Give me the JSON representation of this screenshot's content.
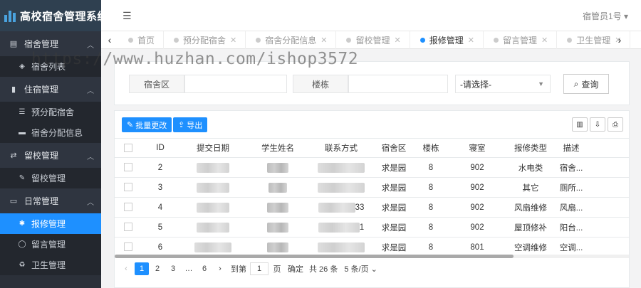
{
  "app": {
    "title": "高校宿舍管理系统"
  },
  "topbar": {
    "user": "宿管员1号 ▾"
  },
  "watermark": "https://www.huzhan.com/ishop3572",
  "sidebar": {
    "groups": [
      {
        "label": "宿舍管理",
        "icon": "building-icon",
        "items": [
          {
            "label": "宿舍列表",
            "icon": "cube-icon"
          }
        ]
      },
      {
        "label": "住宿管理",
        "icon": "bar-chart-icon",
        "items": [
          {
            "label": "预分配宿舍",
            "icon": "list-icon"
          },
          {
            "label": "宿舍分配信息",
            "icon": "bed-icon"
          }
        ]
      },
      {
        "label": "留校管理",
        "icon": "exchange-icon",
        "items": [
          {
            "label": "留校管理",
            "icon": "edit-icon"
          }
        ]
      },
      {
        "label": "日常管理",
        "icon": "desktop-icon",
        "items": [
          {
            "label": "报修管理",
            "icon": "gear-icon",
            "active": true
          },
          {
            "label": "留言管理",
            "icon": "comment-icon"
          },
          {
            "label": "卫生管理",
            "icon": "recycle-icon"
          }
        ]
      }
    ]
  },
  "tabs": [
    {
      "label": "首页",
      "closable": false
    },
    {
      "label": "预分配宿舍",
      "closable": true
    },
    {
      "label": "宿舍分配信息",
      "closable": true
    },
    {
      "label": "留校管理",
      "closable": true
    },
    {
      "label": "报修管理",
      "closable": true,
      "active": true
    },
    {
      "label": "留言管理",
      "closable": true
    },
    {
      "label": "卫生管理",
      "closable": true
    }
  ],
  "search": {
    "area_label": "宿舍区",
    "building_label": "楼栋",
    "select_value": "-请选择-",
    "button_label": "查询"
  },
  "toolbar": {
    "batch_label": "批量更改",
    "export_label": "导出"
  },
  "table": {
    "columns": [
      "ID",
      "提交日期",
      "学生姓名",
      "联系方式",
      "宿舍区",
      "楼栋",
      "寝室",
      "报修类型",
      "描述"
    ],
    "rows": [
      {
        "id": "2",
        "phone_tail": "",
        "area": "求是园",
        "building": "8",
        "room": "902",
        "type": "水电类",
        "desc": "宿舍..."
      },
      {
        "id": "3",
        "phone_tail": "",
        "area": "求是园",
        "building": "8",
        "room": "902",
        "type": "其它",
        "desc": "厕所..."
      },
      {
        "id": "4",
        "phone_tail": "33",
        "area": "求是园",
        "building": "8",
        "room": "902",
        "type": "风扇维修",
        "desc": "风扇..."
      },
      {
        "id": "5",
        "phone_tail": "1",
        "area": "求是园",
        "building": "8",
        "room": "902",
        "type": "屋顶修补",
        "desc": "阳台..."
      },
      {
        "id": "6",
        "phone_tail": "",
        "area": "求是园",
        "building": "8",
        "room": "801",
        "type": "空调维修",
        "desc": "空调..."
      }
    ]
  },
  "pager": {
    "prev": "‹",
    "pages": [
      "1",
      "2",
      "3",
      "…",
      "6"
    ],
    "next": "›",
    "goto_label": "到第",
    "goto_value": "1",
    "page_unit": "页",
    "confirm": "确定",
    "total": "共 26 条",
    "per_page": "5 条/页"
  }
}
